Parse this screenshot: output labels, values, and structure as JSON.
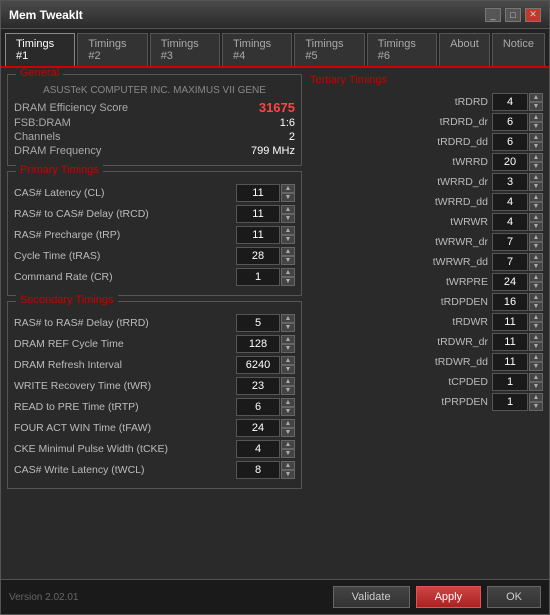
{
  "window": {
    "title": "Mem TweakIt",
    "controls": [
      "minimize",
      "maximize",
      "close"
    ]
  },
  "tabs": [
    {
      "label": "Timings #1",
      "active": true
    },
    {
      "label": "Timings #2",
      "active": false
    },
    {
      "label": "Timings #3",
      "active": false
    },
    {
      "label": "Timings #4",
      "active": false
    },
    {
      "label": "Timings #5",
      "active": false
    },
    {
      "label": "Timings #6",
      "active": false
    },
    {
      "label": "About",
      "active": false
    },
    {
      "label": "Notice",
      "active": false
    }
  ],
  "general": {
    "title": "General",
    "mobo": "ASUSTeK COMPUTER INC. MAXIMUS VII GENE",
    "dram_efficiency_label": "DRAM Efficiency Score",
    "dram_efficiency_value": "31675",
    "fsb_label": "FSB:DRAM",
    "fsb_value": "1:6",
    "channels_label": "Channels",
    "channels_value": "2",
    "freq_label": "DRAM Frequency",
    "freq_value": "799 MHz"
  },
  "primary": {
    "title": "Primary Timings",
    "rows": [
      {
        "label": "CAS# Latency (CL)",
        "value": "11"
      },
      {
        "label": "RAS# to CAS# Delay (tRCD)",
        "value": "11"
      },
      {
        "label": "RAS# Precharge (tRP)",
        "value": "11"
      },
      {
        "label": "Cycle Time (tRAS)",
        "value": "28"
      },
      {
        "label": "Command Rate (CR)",
        "value": "1"
      }
    ]
  },
  "secondary": {
    "title": "Secondary Timings",
    "rows": [
      {
        "label": "RAS# to RAS# Delay (tRRD)",
        "value": "5"
      },
      {
        "label": "DRAM REF Cycle Time",
        "value": "128"
      },
      {
        "label": "DRAM Refresh Interval",
        "value": "6240"
      },
      {
        "label": "WRITE Recovery Time (tWR)",
        "value": "23"
      },
      {
        "label": "READ to PRE Time (tRTP)",
        "value": "6"
      },
      {
        "label": "FOUR ACT WIN Time (tFAW)",
        "value": "24"
      },
      {
        "label": "CKE Minimul Pulse Width (tCKE)",
        "value": "4"
      },
      {
        "label": "CAS# Write Latency (tWCL)",
        "value": "8"
      }
    ]
  },
  "tertiary": {
    "title": "Tertiary Timings",
    "rows": [
      {
        "label": "tRDRD",
        "value": "4"
      },
      {
        "label": "tRDRD_dr",
        "value": "6"
      },
      {
        "label": "tRDRD_dd",
        "value": "6"
      },
      {
        "label": "tWRRD",
        "value": "20"
      },
      {
        "label": "tWRRD_dr",
        "value": "3"
      },
      {
        "label": "tWRRD_dd",
        "value": "4"
      },
      {
        "label": "tWRWR",
        "value": "4"
      },
      {
        "label": "tWRWR_dr",
        "value": "7"
      },
      {
        "label": "tWRWR_dd",
        "value": "7"
      },
      {
        "label": "tWRPRE",
        "value": "24"
      },
      {
        "label": "tRDPDEN",
        "value": "16"
      },
      {
        "label": "tRDWR",
        "value": "11"
      },
      {
        "label": "tRDWR_dr",
        "value": "11"
      },
      {
        "label": "tRDWR_dd",
        "value": "11"
      },
      {
        "label": "tCPDED",
        "value": "1"
      },
      {
        "label": "tPRPDEN",
        "value": "1"
      }
    ]
  },
  "footer": {
    "version": "Version 2.02.01",
    "validate_btn": "Validate",
    "apply_btn": "Apply",
    "ok_btn": "OK"
  }
}
